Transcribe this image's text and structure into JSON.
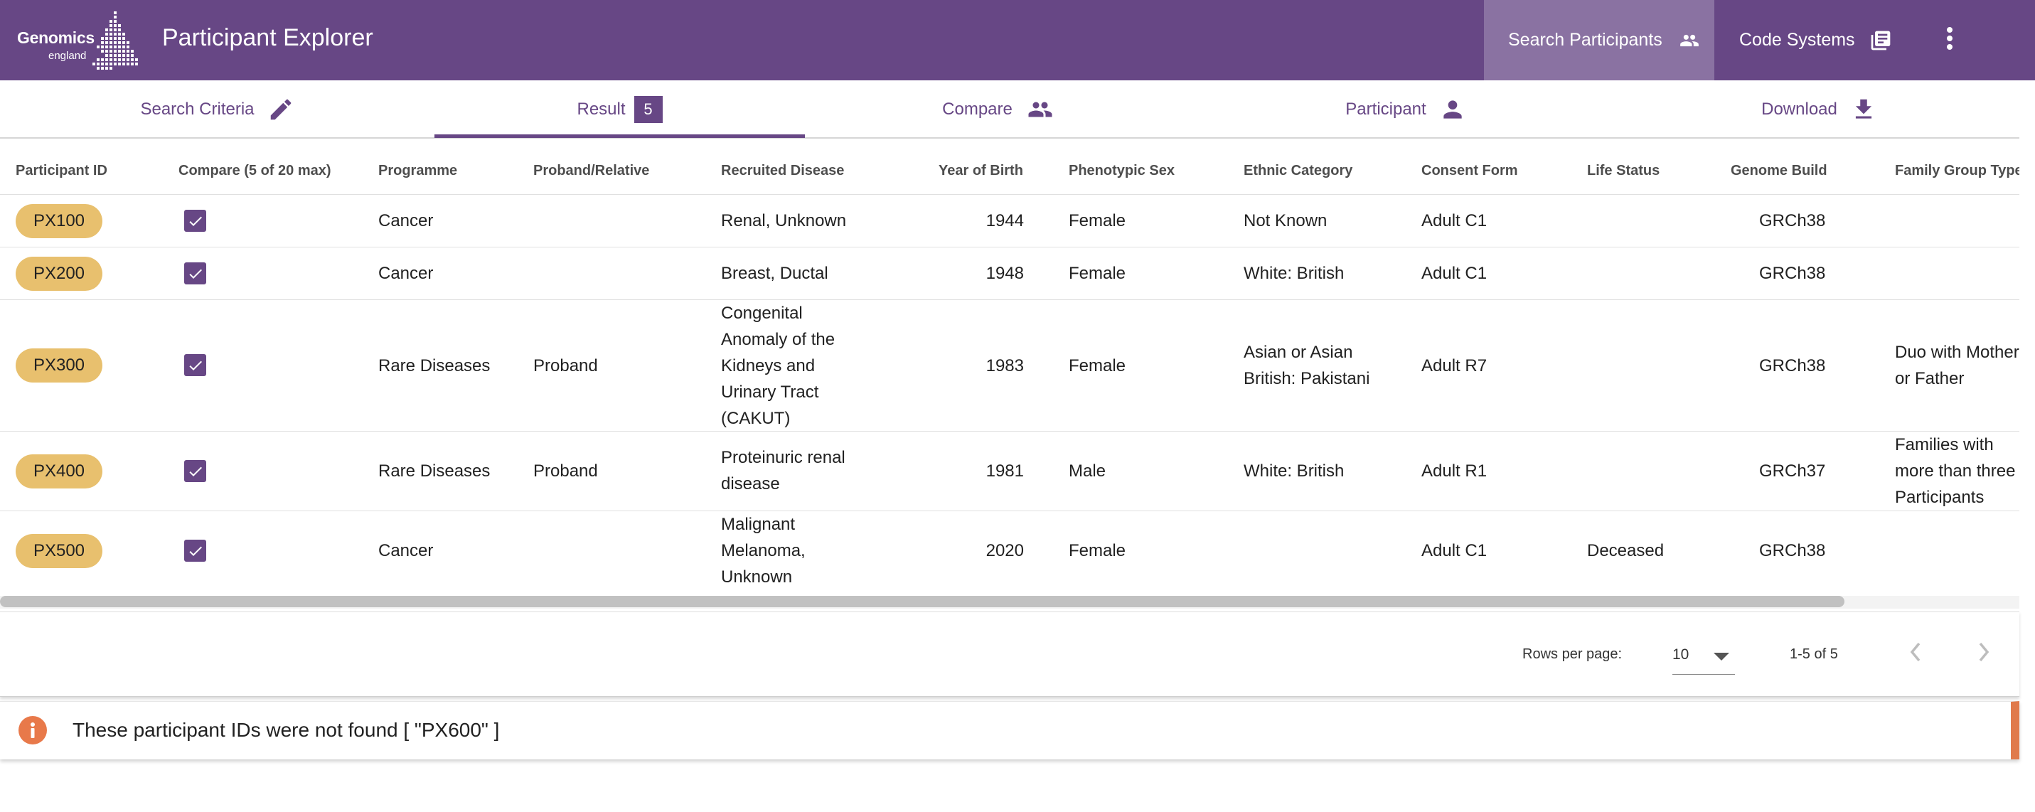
{
  "header": {
    "logo_text": "Genomics",
    "logo_sub": "england",
    "title": "Participant Explorer",
    "nav": [
      {
        "label": "Search Participants",
        "icon": "people-icon"
      },
      {
        "label": "Code Systems",
        "icon": "library-books-icon"
      }
    ],
    "more_icon": "more-vert-icon",
    "colors": {
      "primary": "#674785",
      "active_nav": "#8a72a2"
    }
  },
  "tabs": [
    {
      "label": "Search Criteria",
      "icon": "pencil-icon"
    },
    {
      "label": "Result",
      "badge": "5"
    },
    {
      "label": "Compare",
      "icon": "people-icon"
    },
    {
      "label": "Participant",
      "icon": "person-icon"
    },
    {
      "label": "Download",
      "icon": "download-icon"
    }
  ],
  "table": {
    "columns": [
      "Participant ID",
      "Compare (5 of 20 max)",
      "Programme",
      "Proband/Relative",
      "Recruited Disease",
      "Year of Birth",
      "Phenotypic Sex",
      "Ethnic Category",
      "Consent Form",
      "Life Status",
      "Genome Build",
      "Family Group Type"
    ],
    "rows": [
      {
        "id": "PX100",
        "compare": true,
        "programme": "Cancer",
        "proband": "",
        "disease": "Renal, Unknown",
        "yob": "1944",
        "sex": "Female",
        "ethnic": "Not Known",
        "consent": "Adult C1",
        "life": "",
        "build": "GRCh38",
        "family": ""
      },
      {
        "id": "PX200",
        "compare": true,
        "programme": "Cancer",
        "proband": "",
        "disease": "Breast, Ductal",
        "yob": "1948",
        "sex": "Female",
        "ethnic": "White: British",
        "consent": "Adult C1",
        "life": "",
        "build": "GRCh38",
        "family": ""
      },
      {
        "id": "PX300",
        "compare": true,
        "programme": "Rare Diseases",
        "proband": "Proband",
        "disease": "Congenital Anomaly of the Kidneys and Urinary Tract (CAKUT)",
        "yob": "1983",
        "sex": "Female",
        "ethnic": "Asian or Asian British: Pakistani",
        "consent": "Adult R7",
        "life": "",
        "build": "GRCh38",
        "family": "Duo with Mother or Father"
      },
      {
        "id": "PX400",
        "compare": true,
        "programme": "Rare Diseases",
        "proband": "Proband",
        "disease": "Proteinuric renal disease",
        "yob": "1981",
        "sex": "Male",
        "ethnic": "White: British",
        "consent": "Adult R1",
        "life": "",
        "build": "GRCh37",
        "family": "Families with more than three Participants"
      },
      {
        "id": "PX500",
        "compare": true,
        "programme": "Cancer",
        "proband": "",
        "disease": "Malignant Melanoma, Unknown",
        "yob": "2020",
        "sex": "Female",
        "ethnic": "",
        "consent": "Adult C1",
        "life": "Deceased",
        "build": "GRCh38",
        "family": ""
      }
    ]
  },
  "pagination": {
    "rows_per_page_label": "Rows per page:",
    "rows_per_page": "10",
    "range": "1-5 of 5"
  },
  "alert": {
    "message": "These participant IDs were not found [ \"PX600\" ]",
    "icon": "info-icon",
    "color": "#e07a4b"
  }
}
